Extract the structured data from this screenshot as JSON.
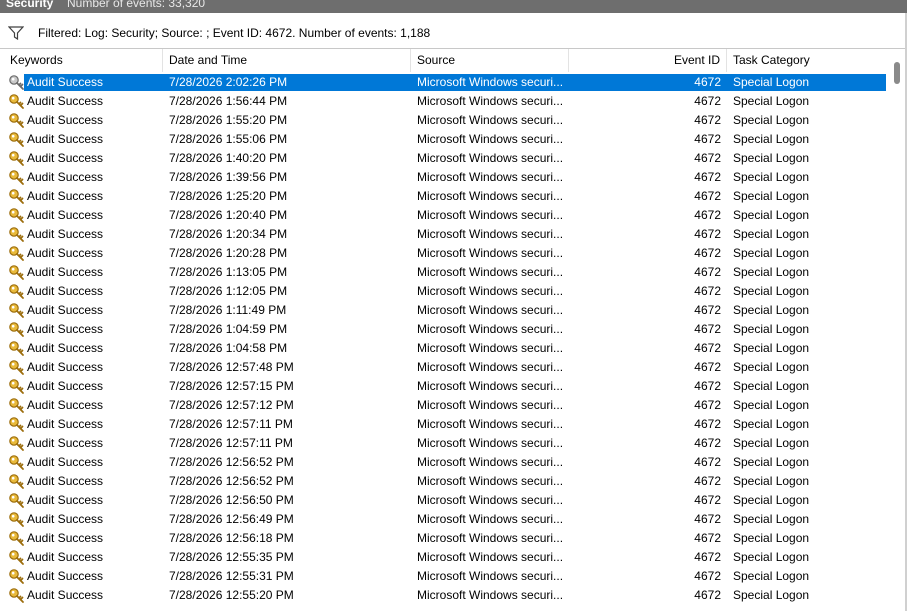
{
  "titlebar": {
    "log_name": "Security",
    "event_count": "Number of events: 33,320"
  },
  "filter": {
    "text": "Filtered: Log: Security; Source: ; Event ID: 4672. Number of events: 1,188"
  },
  "columns": {
    "keywords": "Keywords",
    "date": "Date and Time",
    "source": "Source",
    "event_id": "Event ID",
    "task_category": "Task Category"
  },
  "colors": {
    "selection": "#0078d7",
    "titlebar": "#6e6e6e",
    "key_gold": "#d9a520"
  },
  "selected_row": 0,
  "rows": [
    {
      "keyword": "Audit Success",
      "date": "7/28/2026 2:02:26 PM",
      "source": "Microsoft Windows securi...",
      "event_id": "4672",
      "task": "Special Logon"
    },
    {
      "keyword": "Audit Success",
      "date": "7/28/2026 1:56:44 PM",
      "source": "Microsoft Windows securi...",
      "event_id": "4672",
      "task": "Special Logon"
    },
    {
      "keyword": "Audit Success",
      "date": "7/28/2026 1:55:20 PM",
      "source": "Microsoft Windows securi...",
      "event_id": "4672",
      "task": "Special Logon"
    },
    {
      "keyword": "Audit Success",
      "date": "7/28/2026 1:55:06 PM",
      "source": "Microsoft Windows securi...",
      "event_id": "4672",
      "task": "Special Logon"
    },
    {
      "keyword": "Audit Success",
      "date": "7/28/2026 1:40:20 PM",
      "source": "Microsoft Windows securi...",
      "event_id": "4672",
      "task": "Special Logon"
    },
    {
      "keyword": "Audit Success",
      "date": "7/28/2026 1:39:56 PM",
      "source": "Microsoft Windows securi...",
      "event_id": "4672",
      "task": "Special Logon"
    },
    {
      "keyword": "Audit Success",
      "date": "7/28/2026 1:25:20 PM",
      "source": "Microsoft Windows securi...",
      "event_id": "4672",
      "task": "Special Logon"
    },
    {
      "keyword": "Audit Success",
      "date": "7/28/2026 1:20:40 PM",
      "source": "Microsoft Windows securi...",
      "event_id": "4672",
      "task": "Special Logon"
    },
    {
      "keyword": "Audit Success",
      "date": "7/28/2026 1:20:34 PM",
      "source": "Microsoft Windows securi...",
      "event_id": "4672",
      "task": "Special Logon"
    },
    {
      "keyword": "Audit Success",
      "date": "7/28/2026 1:20:28 PM",
      "source": "Microsoft Windows securi...",
      "event_id": "4672",
      "task": "Special Logon"
    },
    {
      "keyword": "Audit Success",
      "date": "7/28/2026 1:13:05 PM",
      "source": "Microsoft Windows securi...",
      "event_id": "4672",
      "task": "Special Logon"
    },
    {
      "keyword": "Audit Success",
      "date": "7/28/2026 1:12:05 PM",
      "source": "Microsoft Windows securi...",
      "event_id": "4672",
      "task": "Special Logon"
    },
    {
      "keyword": "Audit Success",
      "date": "7/28/2026 1:11:49 PM",
      "source": "Microsoft Windows securi...",
      "event_id": "4672",
      "task": "Special Logon"
    },
    {
      "keyword": "Audit Success",
      "date": "7/28/2026 1:04:59 PM",
      "source": "Microsoft Windows securi...",
      "event_id": "4672",
      "task": "Special Logon"
    },
    {
      "keyword": "Audit Success",
      "date": "7/28/2026 1:04:58 PM",
      "source": "Microsoft Windows securi...",
      "event_id": "4672",
      "task": "Special Logon"
    },
    {
      "keyword": "Audit Success",
      "date": "7/28/2026 12:57:48 PM",
      "source": "Microsoft Windows securi...",
      "event_id": "4672",
      "task": "Special Logon"
    },
    {
      "keyword": "Audit Success",
      "date": "7/28/2026 12:57:15 PM",
      "source": "Microsoft Windows securi...",
      "event_id": "4672",
      "task": "Special Logon"
    },
    {
      "keyword": "Audit Success",
      "date": "7/28/2026 12:57:12 PM",
      "source": "Microsoft Windows securi...",
      "event_id": "4672",
      "task": "Special Logon"
    },
    {
      "keyword": "Audit Success",
      "date": "7/28/2026 12:57:11 PM",
      "source": "Microsoft Windows securi...",
      "event_id": "4672",
      "task": "Special Logon"
    },
    {
      "keyword": "Audit Success",
      "date": "7/28/2026 12:57:11 PM",
      "source": "Microsoft Windows securi...",
      "event_id": "4672",
      "task": "Special Logon"
    },
    {
      "keyword": "Audit Success",
      "date": "7/28/2026 12:56:52 PM",
      "source": "Microsoft Windows securi...",
      "event_id": "4672",
      "task": "Special Logon"
    },
    {
      "keyword": "Audit Success",
      "date": "7/28/2026 12:56:52 PM",
      "source": "Microsoft Windows securi...",
      "event_id": "4672",
      "task": "Special Logon"
    },
    {
      "keyword": "Audit Success",
      "date": "7/28/2026 12:56:50 PM",
      "source": "Microsoft Windows securi...",
      "event_id": "4672",
      "task": "Special Logon"
    },
    {
      "keyword": "Audit Success",
      "date": "7/28/2026 12:56:49 PM",
      "source": "Microsoft Windows securi...",
      "event_id": "4672",
      "task": "Special Logon"
    },
    {
      "keyword": "Audit Success",
      "date": "7/28/2026 12:56:18 PM",
      "source": "Microsoft Windows securi...",
      "event_id": "4672",
      "task": "Special Logon"
    },
    {
      "keyword": "Audit Success",
      "date": "7/28/2026 12:55:35 PM",
      "source": "Microsoft Windows securi...",
      "event_id": "4672",
      "task": "Special Logon"
    },
    {
      "keyword": "Audit Success",
      "date": "7/28/2026 12:55:31 PM",
      "source": "Microsoft Windows securi...",
      "event_id": "4672",
      "task": "Special Logon"
    },
    {
      "keyword": "Audit Success",
      "date": "7/28/2026 12:55:20 PM",
      "source": "Microsoft Windows securi...",
      "event_id": "4672",
      "task": "Special Logon"
    }
  ]
}
